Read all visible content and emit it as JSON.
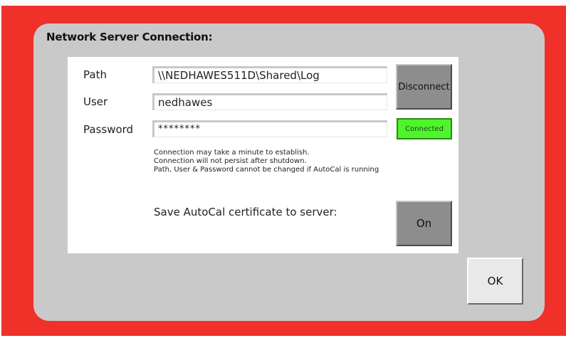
{
  "colors": {
    "frame": "#ef3129",
    "dialog": "#c9c9c9",
    "panel": "#ffffff",
    "connected": "#4ef42c",
    "button": "#8d8d8d"
  },
  "title": "Network Server Connection:",
  "form": {
    "path_label": "Path",
    "path_value": "\\\\NEDHAWES511D\\Shared\\Log",
    "user_label": "User",
    "user_value": "nedhawes",
    "password_label": "Password",
    "password_value": "********"
  },
  "buttons": {
    "disconnect": "Disconnect",
    "certificate_toggle": "On",
    "ok": "OK"
  },
  "status": "Connected",
  "notes": [
    "Connection may take a minute to establish.",
    "Connection will not persist after shutdown.",
    "Path, User & Password cannot be changed if AutoCal is running"
  ],
  "certificate_label": "Save AutoCal certificate to server:"
}
